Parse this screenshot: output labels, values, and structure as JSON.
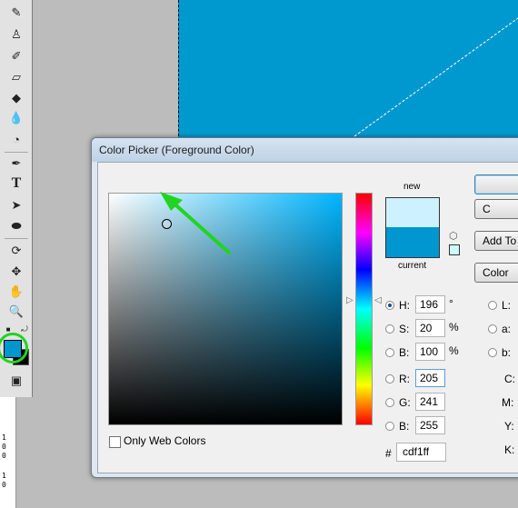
{
  "dialog": {
    "title": "Color Picker (Foreground Color)",
    "only_web_colors": "Only Web Colors",
    "new_label": "new",
    "current_label": "current",
    "buttons": {
      "ok": "",
      "cancel": "C",
      "add_to_swatches": "Add To",
      "color_libraries": "Color"
    },
    "fields": {
      "H": {
        "label": "H:",
        "value": "196",
        "unit": "°"
      },
      "S": {
        "label": "S:",
        "value": "20",
        "unit": "%"
      },
      "Bv": {
        "label": "B:",
        "value": "100",
        "unit": "%"
      },
      "R": {
        "label": "R:",
        "value": "205"
      },
      "G": {
        "label": "G:",
        "value": "241"
      },
      "Bc": {
        "label": "B:",
        "value": "255"
      },
      "L": {
        "label": "L:"
      },
      "a": {
        "label": "a:"
      },
      "b": {
        "label": "b:"
      },
      "C": {
        "label": "C:"
      },
      "M": {
        "label": "M:"
      },
      "Y": {
        "label": "Y:"
      },
      "K": {
        "label": "K:"
      }
    },
    "hex_hash": "#",
    "hex_value": "cdf1ff",
    "selected_mode": "H"
  },
  "colors": {
    "new_color": "#cdf1ff",
    "current_color": "#0096cf",
    "canvas_fill": "#0099cf",
    "annotation": "#21d421"
  },
  "toolbar": {
    "tools": [
      "brush-icon",
      "clone-stamp-icon",
      "history-brush-icon",
      "eraser-icon",
      "paint-bucket-icon",
      "blur-icon",
      "dodge-icon",
      "pen-icon",
      "type-icon",
      "path-selection-icon",
      "ellipse-icon",
      "3d-rotate-icon",
      "3d-pan-icon",
      "hand-icon",
      "zoom-icon"
    ],
    "type_glyph": "T"
  },
  "ruler": {
    "labels": [
      "1",
      "0",
      "0",
      "1",
      "0"
    ]
  }
}
